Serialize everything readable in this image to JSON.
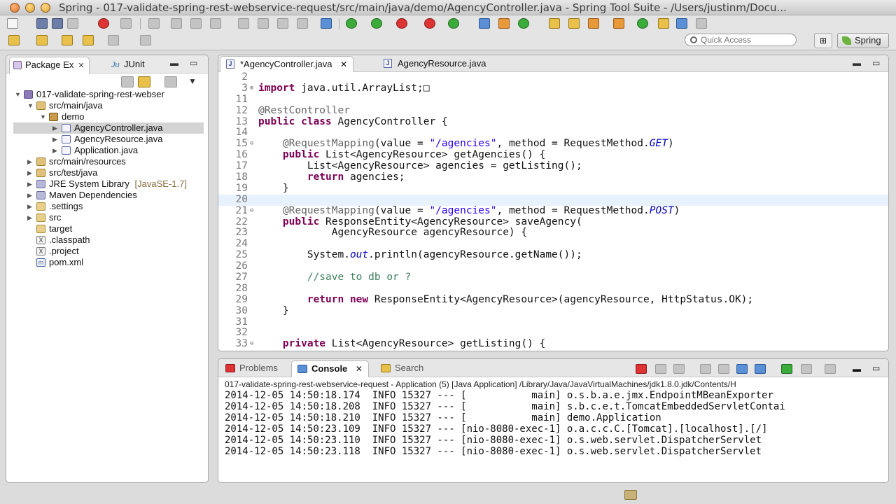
{
  "window": {
    "title": "Spring - 017-validate-spring-rest-webservice-request/src/main/java/demo/AgencyController.java - Spring Tool Suite - /Users/justinm/Docu..."
  },
  "toolbar": {
    "quick_access_placeholder": "Quick Access",
    "perspective_label": "Spring"
  },
  "package_explorer": {
    "tabs": [
      {
        "label": "Package Ex",
        "active": true
      },
      {
        "label": "JUnit",
        "active": false
      }
    ],
    "tree": [
      {
        "label": "017-validate-spring-rest-webser",
        "icon": "project-icon",
        "level": 0,
        "expanded": true
      },
      {
        "label": "src/main/java",
        "icon": "source-folder-icon",
        "level": 1,
        "expanded": true
      },
      {
        "label": "demo",
        "icon": "package-icon",
        "level": 2,
        "expanded": true
      },
      {
        "label": "AgencyController.java",
        "icon": "java-file-icon",
        "level": 3,
        "expanded": false,
        "selected": true
      },
      {
        "label": "AgencyResource.java",
        "icon": "java-file-icon",
        "level": 3,
        "expanded": false
      },
      {
        "label": "Application.java",
        "icon": "java-file-icon",
        "level": 3,
        "expanded": false
      },
      {
        "label": "src/main/resources",
        "icon": "source-folder-icon",
        "level": 1,
        "expanded": false
      },
      {
        "label": "src/test/java",
        "icon": "source-folder-icon",
        "level": 1,
        "expanded": false
      },
      {
        "label": "JRE System Library",
        "suffix": "[JavaSE-1.7]",
        "icon": "library-icon",
        "level": 1,
        "expanded": false
      },
      {
        "label": "Maven Dependencies",
        "icon": "library-icon",
        "level": 1,
        "expanded": false
      },
      {
        "label": ".settings",
        "icon": "folder-icon",
        "level": 1,
        "expanded": false
      },
      {
        "label": "src",
        "icon": "folder-icon",
        "level": 1,
        "expanded": false
      },
      {
        "label": "target",
        "icon": "folder-icon",
        "level": 1,
        "leaf": true
      },
      {
        "label": ".classpath",
        "icon": "xml-file-icon",
        "level": 1,
        "leaf": true
      },
      {
        "label": ".project",
        "icon": "xml-file-icon",
        "level": 1,
        "leaf": true
      },
      {
        "label": "pom.xml",
        "icon": "maven-file-icon",
        "level": 1,
        "leaf": true
      }
    ]
  },
  "editor": {
    "tabs": [
      {
        "label": "*AgencyController.java",
        "active": true
      },
      {
        "label": "AgencyResource.java",
        "active": false
      }
    ],
    "lines": [
      {
        "num": "2",
        "fold": "",
        "html": ""
      },
      {
        "num": "3",
        "fold": "⊕",
        "html": "<span class='kw'>import</span> java.util.ArrayList;&#9633;"
      },
      {
        "num": "11",
        "fold": "",
        "html": ""
      },
      {
        "num": "12",
        "fold": "",
        "html": "<span class='ann'>@RestController</span>"
      },
      {
        "num": "13",
        "fold": "",
        "html": "<span class='kw'>public class</span> AgencyController {"
      },
      {
        "num": "14",
        "fold": "",
        "html": ""
      },
      {
        "num": "15",
        "fold": "⊖",
        "html": "    <span class='ann'>@RequestMapping</span>(value = <span class='str'>\"/agencies\"</span>, method = RequestMethod.<span class='ital'>GET</span>)"
      },
      {
        "num": "16",
        "fold": "",
        "html": "    <span class='kw'>public</span> List&lt;AgencyResource&gt; getAgencies() {"
      },
      {
        "num": "17",
        "fold": "",
        "html": "        List&lt;AgencyResource&gt; agencies = getListing();"
      },
      {
        "num": "18",
        "fold": "",
        "html": "        <span class='kw'>return</span> agencies;"
      },
      {
        "num": "19",
        "fold": "",
        "html": "    }"
      },
      {
        "num": "20",
        "fold": "",
        "html": "",
        "highlight": true
      },
      {
        "num": "21",
        "fold": "⊖",
        "html": "    <span class='ann'>@RequestMapping</span>(value = <span class='str'>\"/agencies\"</span>, method = RequestMethod.<span class='ital'>POST</span>)"
      },
      {
        "num": "22",
        "fold": "",
        "html": "    <span class='kw'>public</span> ResponseEntity&lt;AgencyResource&gt; saveAgency("
      },
      {
        "num": "23",
        "fold": "",
        "html": "            AgencyResource agencyResource) {"
      },
      {
        "num": "24",
        "fold": "",
        "html": ""
      },
      {
        "num": "25",
        "fold": "",
        "html": "        System.<span class='ital'>out</span>.println(agencyResource.getName());"
      },
      {
        "num": "26",
        "fold": "",
        "html": ""
      },
      {
        "num": "27",
        "fold": "",
        "html": "        <span class='cmt'>//save to db or ?</span>"
      },
      {
        "num": "28",
        "fold": "",
        "html": ""
      },
      {
        "num": "29",
        "fold": "",
        "html": "        <span class='kw'>return new</span> ResponseEntity&lt;AgencyResource&gt;(agencyResource, HttpStatus.OK);"
      },
      {
        "num": "30",
        "fold": "",
        "html": "    }"
      },
      {
        "num": "31",
        "fold": "",
        "html": ""
      },
      {
        "num": "32",
        "fold": "",
        "html": ""
      },
      {
        "num": "33",
        "fold": "⊖",
        "html": "    <span class='kw'>private</span> List&lt;AgencyResource&gt; getListing() {"
      }
    ]
  },
  "console": {
    "tabs": [
      {
        "label": "Problems",
        "active": false
      },
      {
        "label": "Console",
        "active": true
      },
      {
        "label": "Search",
        "active": false
      }
    ],
    "launch_path": "017-validate-spring-rest-webservice-request - Application (5) [Java Application] /Library/Java/JavaVirtualMachines/jdk1.8.0.jdk/Contents/H",
    "lines": [
      "2014-12-05 14:50:18.174  INFO 15327 --- [           main] o.s.b.a.e.jmx.EndpointMBeanExporter",
      "2014-12-05 14:50:18.208  INFO 15327 --- [           main] s.b.c.e.t.TomcatEmbeddedServletContai",
      "2014-12-05 14:50:18.210  INFO 15327 --- [           main] demo.Application",
      "2014-12-05 14:50:23.109  INFO 15327 --- [nio-8080-exec-1] o.a.c.c.C.[Tomcat].[localhost].[/]",
      "2014-12-05 14:50:23.110  INFO 15327 --- [nio-8080-exec-1] o.s.web.servlet.DispatcherServlet",
      "2014-12-05 14:50:23.118  INFO 15327 --- [nio-8080-exec-1] o.s.web.servlet.DispatcherServlet"
    ]
  }
}
